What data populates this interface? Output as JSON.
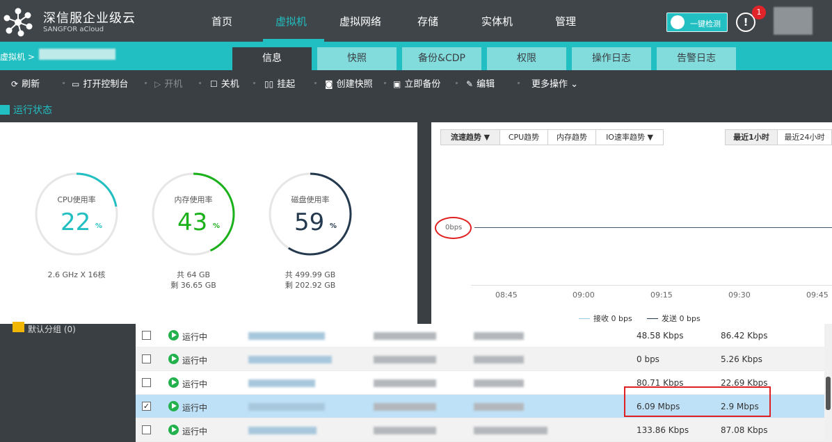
{
  "app": {
    "name": "深信服企业级云",
    "sub": "SANGFOR aCloud"
  },
  "nav": [
    "首页",
    "虚拟机",
    "虚拟网络",
    "存储",
    "实体机",
    "管理"
  ],
  "header": {
    "check_label": "一键检测",
    "alert_glyph": "!",
    "alert_count": "1"
  },
  "breadcrumb": {
    "root": "虚拟机 >"
  },
  "tabs": [
    "信息",
    "快照",
    "备份&CDP",
    "权限",
    "操作日志",
    "告警日志"
  ],
  "toolbar": {
    "refresh": "刷新",
    "console": "打开控制台",
    "power_on": "开机",
    "power_off": "关机",
    "suspend": "挂起",
    "snapshot": "创建快照",
    "backup": "立即备份",
    "edit": "编辑",
    "more": "更多操作"
  },
  "section": {
    "title": "运行状态"
  },
  "gauges": {
    "cpu": {
      "title": "CPU使用率",
      "value": "22",
      "pct": "%",
      "sub1": "2.6 GHz X 16核",
      "sub2": "",
      "color": "#22bfc2"
    },
    "mem": {
      "title": "内存使用率",
      "value": "43",
      "pct": "%",
      "sub1": "共 64 GB",
      "sub2": "剩 36.65 GB",
      "color": "#1ab11a"
    },
    "disk": {
      "title": "磁盘使用率",
      "value": "59",
      "pct": "%",
      "sub1": "共 499.99 GB",
      "sub2": "剩 202.92 GB",
      "color": "#24394d"
    }
  },
  "chart": {
    "tabs": [
      "流速趋势 ▼",
      "CPU趋势",
      "内存趋势",
      "IO速率趋势 ▼"
    ],
    "ranges": [
      "最近1小时",
      "最近24小时"
    ],
    "y_label": "0bps",
    "ticks": [
      "08:45",
      "09:00",
      "09:15",
      "09:30",
      "09:45"
    ],
    "legend": [
      "接收 0 bps",
      "发送 0 bps"
    ]
  },
  "chart_data": {
    "type": "line",
    "x": [
      "08:45",
      "09:00",
      "09:15",
      "09:30",
      "09:45"
    ],
    "series": [
      {
        "name": "接收 0 bps",
        "values": [
          0,
          0,
          0,
          0,
          0
        ]
      },
      {
        "name": "发送 0 bps",
        "values": [
          0,
          0,
          0,
          0,
          0
        ]
      }
    ],
    "ylabel": "0bps"
  },
  "tree": {
    "group": "默认分组 (0)"
  },
  "rows": [
    {
      "status": "运行中",
      "rx": "48.58 Kbps",
      "tx": "86.42 Kbps",
      "checked": false
    },
    {
      "status": "运行中",
      "rx": "0 bps",
      "tx": "5.26 Kbps",
      "checked": false
    },
    {
      "status": "运行中",
      "rx": "80.71 Kbps",
      "tx": "22.69 Kbps",
      "checked": false
    },
    {
      "status": "运行中",
      "rx": "6.09 Mbps",
      "tx": "2.9 Mbps",
      "checked": true
    },
    {
      "status": "运行中",
      "rx": "133.86 Kbps",
      "tx": "87.08 Kbps",
      "checked": false
    }
  ],
  "checkmark": "✓"
}
